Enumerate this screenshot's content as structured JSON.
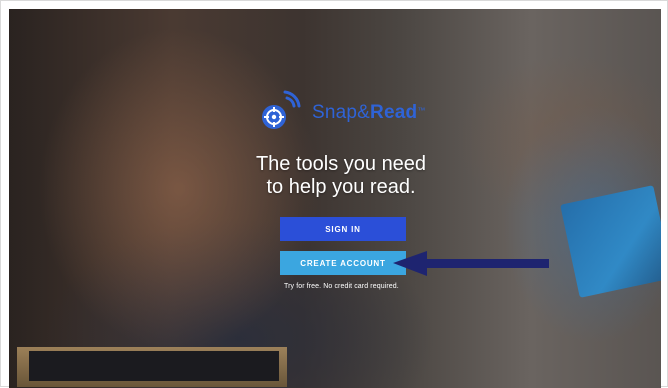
{
  "brand": {
    "name_part1": "Snap&",
    "name_part2": "Read",
    "trademark": "™",
    "logo_icon": "crosshair-target-icon",
    "color": "#2f63d6"
  },
  "hero": {
    "tagline_line1": "The tools you need",
    "tagline_line2": "to help you read."
  },
  "actions": {
    "signin_label": "SIGN IN",
    "signin_color": "#2b4fd8",
    "create_label": "CREATE ACCOUNT",
    "create_color": "#3ba6e0",
    "note": "Try for free. No credit card required."
  },
  "annotation": {
    "arrow_icon": "arrow-left-icon",
    "arrow_color": "#1e2470"
  }
}
